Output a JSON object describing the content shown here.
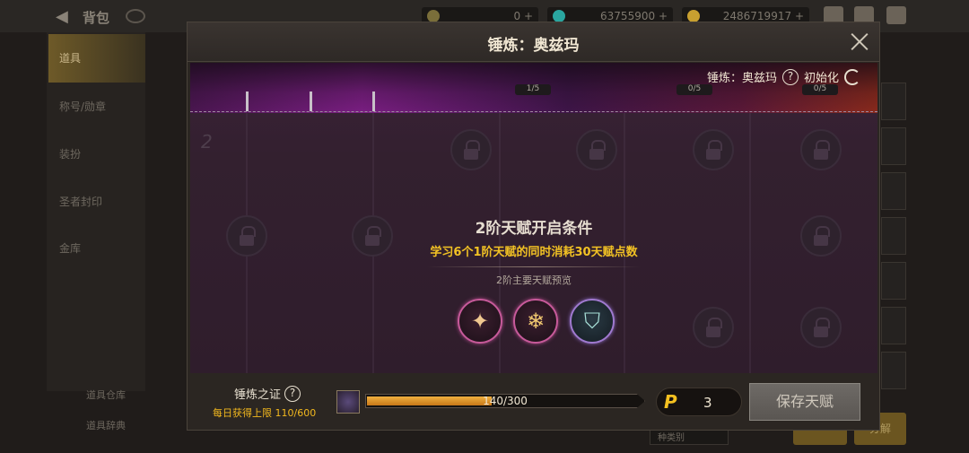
{
  "background": {
    "title": "背包",
    "resources": [
      {
        "value": "0",
        "plus": "+",
        "coin_color": "#7a6e3a"
      },
      {
        "value": "63755900",
        "plus": "+",
        "coin_color": "#2aa6a0"
      },
      {
        "value": "2486719917",
        "plus": "+",
        "coin_color": "#c8a030"
      }
    ],
    "sidebar": [
      "道具",
      "称号/勋章",
      "装扮",
      "圣者封印",
      "金库"
    ],
    "bottom_links": [
      "道具仓库",
      "道具辞典"
    ],
    "right_buttons": [
      "",
      "分解"
    ],
    "dropdown": "种类别"
  },
  "modal": {
    "title": "锤炼：奥兹玛",
    "close_icon": "close-icon"
  },
  "talent": {
    "reset_label_prefix": "锤炼：奥兹玛",
    "help_glyph": "?",
    "reset_label": "初始化",
    "banner_counts": [
      "1/5",
      "0/5",
      "0/5"
    ],
    "tier_label": "2",
    "condition_title": "2阶天赋开启条件",
    "condition_desc": "学习6个1阶天赋的同时消耗30天赋点数",
    "preview_label": "2阶主要天赋预览",
    "preview_icons": [
      {
        "name": "burst-slash-icon",
        "glyph": "✦"
      },
      {
        "name": "snowflake-icon",
        "glyph": "❄"
      },
      {
        "name": "ice-shield-icon",
        "glyph": "⛉"
      }
    ]
  },
  "footer": {
    "proof_label": "锤炼之证",
    "help_glyph": "?",
    "daily_limit": "每日获得上限 110/600",
    "progress_text": "140/300",
    "progress_fraction": 0.4667,
    "points_glyph": "P",
    "points_value": "3",
    "save_label": "保存天赋"
  }
}
